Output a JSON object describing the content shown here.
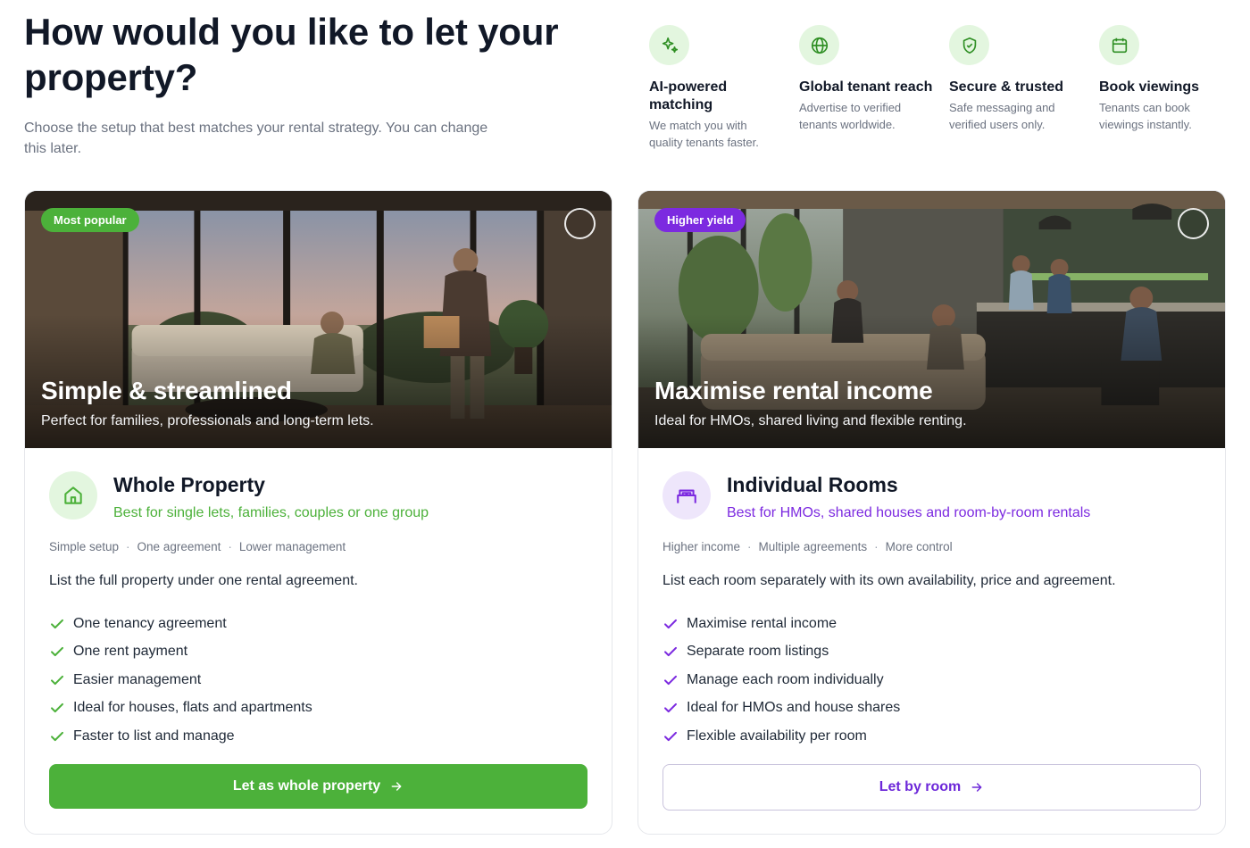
{
  "header": {
    "title": "How would you like to let your property?",
    "subtitle": "Choose the setup that best matches your rental strategy. You can change this later."
  },
  "features": [
    {
      "icon": "sparkles-icon",
      "title": "AI-powered matching",
      "desc": "We match you with quality tenants faster."
    },
    {
      "icon": "globe-icon",
      "title": "Global tenant reach",
      "desc": "Advertise to verified tenants worldwide."
    },
    {
      "icon": "shield-check-icon",
      "title": "Secure & trusted",
      "desc": "Safe messaging and verified users only."
    },
    {
      "icon": "calendar-icon",
      "title": "Book viewings",
      "desc": "Tenants can book viewings instantly."
    }
  ],
  "options": [
    {
      "badge": "Most popular",
      "hero_title": "Simple & streamlined",
      "hero_subtitle": "Perfect for families, professionals and long-term lets.",
      "icon": "house-icon",
      "title": "Whole Property",
      "tagline": "Best for single lets, families, couples or one group",
      "meta": [
        "Simple setup",
        "One agreement",
        "Lower management"
      ],
      "description": "List the full property under one rental agreement.",
      "benefits": [
        "One tenancy agreement",
        "One rent payment",
        "Easier management",
        "Ideal for houses, flats and apartments",
        "Faster to list and manage"
      ],
      "cta": "Let as whole property",
      "accent": "#4cb13a"
    },
    {
      "badge": "Higher yield",
      "hero_title": "Maximise rental income",
      "hero_subtitle": "Ideal for HMOs, shared living and flexible renting.",
      "icon": "bed-icon",
      "title": "Individual Rooms",
      "tagline": "Best for HMOs, shared houses and room-by-room rentals",
      "meta": [
        "Higher income",
        "Multiple agreements",
        "More control"
      ],
      "description": "List each room separately with its own availability, price and agreement.",
      "benefits": [
        "Maximise rental income",
        "Separate room listings",
        "Manage each room individually",
        "Ideal for HMOs and house shares",
        "Flexible availability per room"
      ],
      "cta": "Let by room",
      "accent": "#7c2ae0"
    }
  ],
  "meta_separator": "·"
}
